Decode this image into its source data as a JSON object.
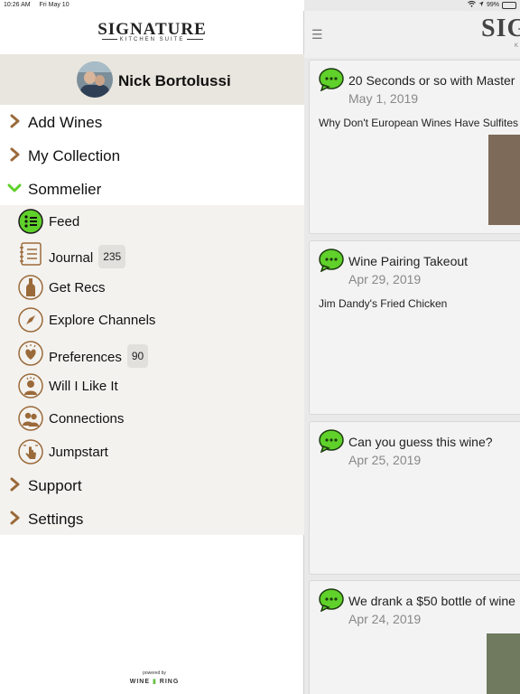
{
  "status_bar": {
    "time": "10:26 AM",
    "date": "Fri May 10",
    "battery": "99%"
  },
  "drawer": {
    "logo": {
      "main": "SIGNATURE",
      "sub": "KITCHEN SUITE"
    },
    "profile": {
      "name": "Nick Bortolussi"
    },
    "menu_top": [
      {
        "label": "Add Wines",
        "expanded": false
      },
      {
        "label": "My Collection",
        "expanded": false
      },
      {
        "label": "Sommelier",
        "expanded": true
      }
    ],
    "sommelier_items": [
      {
        "label": "Feed",
        "icon": "feed-icon",
        "active": true
      },
      {
        "label": "Journal",
        "icon": "journal-icon",
        "badge": "235"
      },
      {
        "label": "Get Recs",
        "icon": "bottle-icon"
      },
      {
        "label": "Explore Channels",
        "icon": "compass-icon"
      },
      {
        "label": "Preferences",
        "icon": "heart-icon",
        "badge": "90"
      },
      {
        "label": "Will I Like It",
        "icon": "person-idea-icon"
      },
      {
        "label": "Connections",
        "icon": "connections-icon"
      },
      {
        "label": "Jumpstart",
        "icon": "tap-icon"
      }
    ],
    "menu_bottom": [
      {
        "label": "Support"
      },
      {
        "label": "Settings"
      }
    ],
    "powered_by": {
      "prefix": "powered by",
      "wine": "WINE",
      "ring": "RING"
    }
  },
  "feed": {
    "brand": "SIG",
    "brand_sub": "K",
    "cards": [
      {
        "title": "20 Seconds or so with Master",
        "date": "May 1, 2019",
        "subtitle": "Why Don't European Wines Have Sulfites"
      },
      {
        "title": "Wine Pairing Takeout",
        "date": "Apr 29, 2019",
        "subtitle": "Jim Dandy's Fried Chicken"
      },
      {
        "title": "Can you guess this wine?",
        "date": "Apr 25, 2019",
        "subtitle": ""
      },
      {
        "title": "We drank a $50 bottle of wine",
        "date": "Apr 24, 2019",
        "subtitle": ""
      }
    ]
  },
  "colors": {
    "accent_brown": "#9b6a3a",
    "accent_green": "#5fd12a",
    "profile_bg": "#e9e6df"
  }
}
